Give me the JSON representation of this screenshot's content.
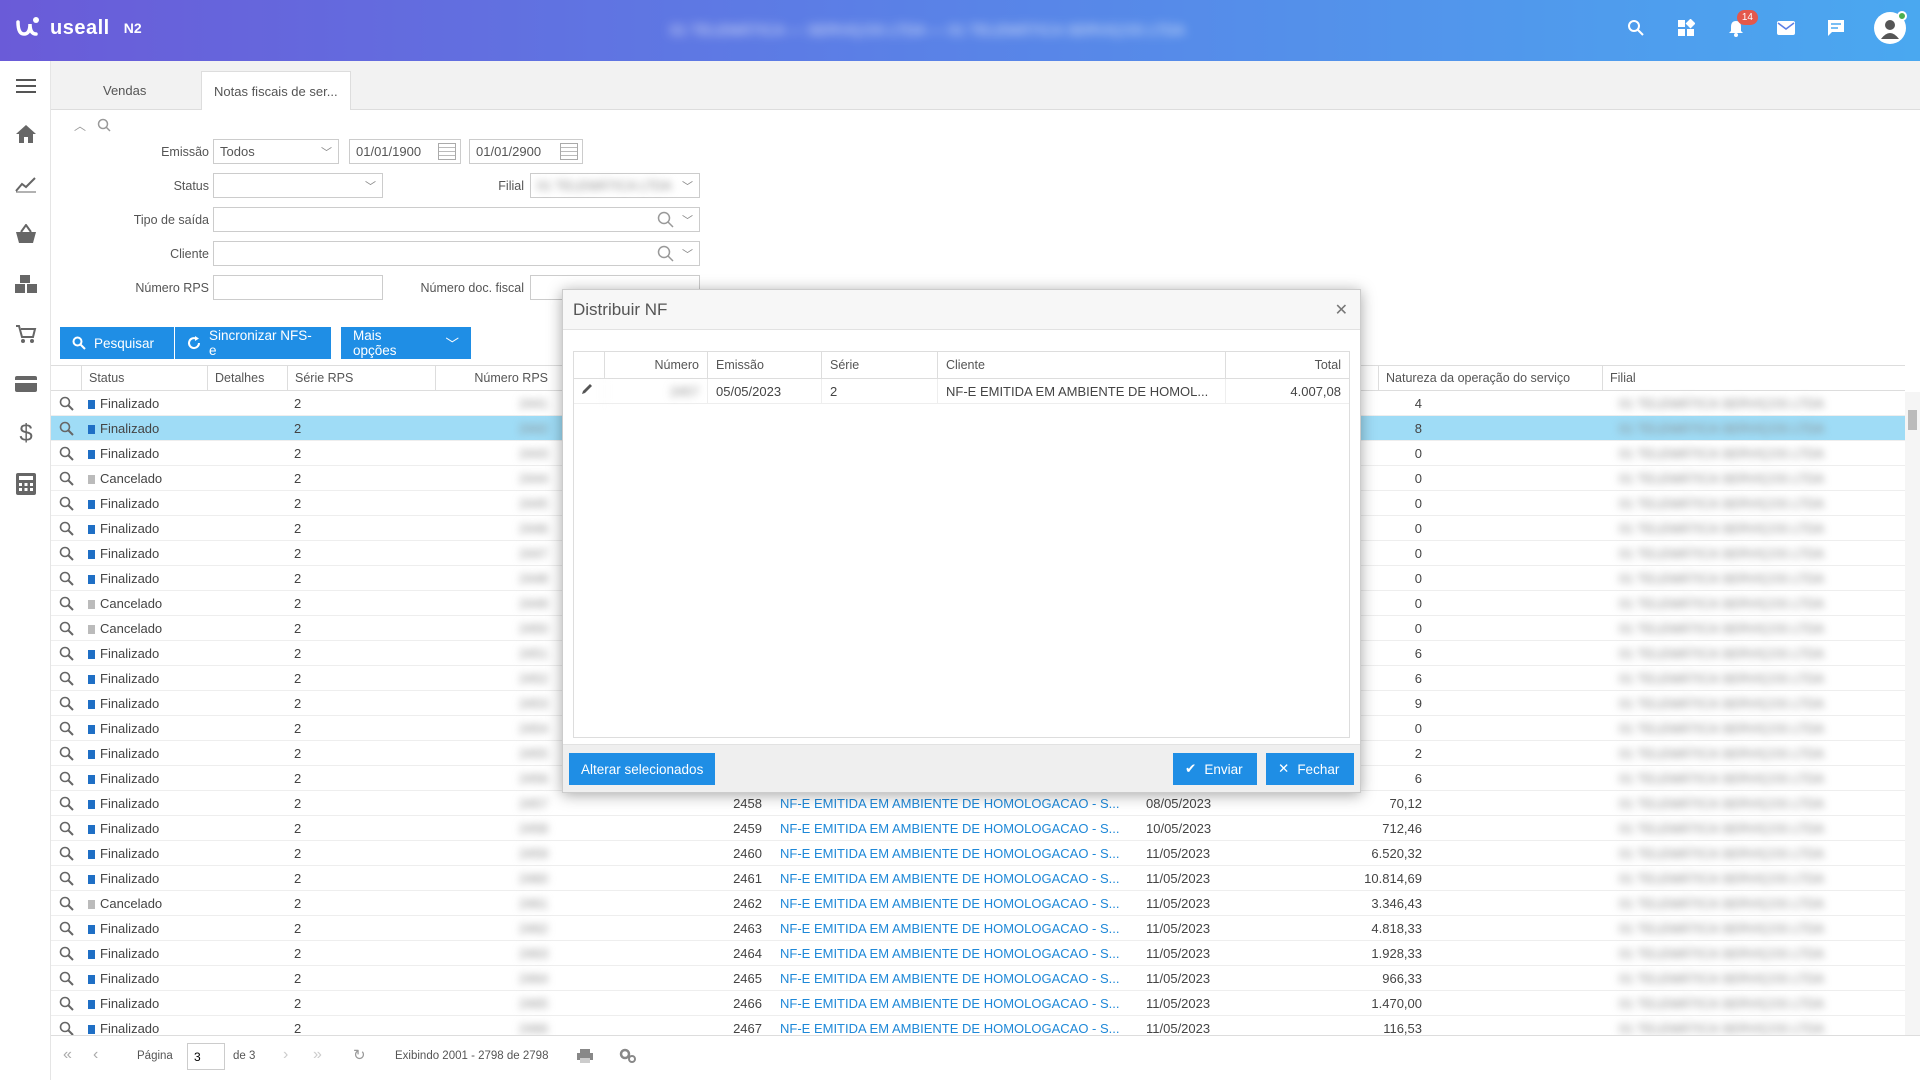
{
  "app": {
    "logo_text": "useall",
    "logo_sub": "N2",
    "top_title": "01 TELEMÁTICA — SERVIÇOS LTDA — 01 TELEMÁTICA SERVIÇOS LTDA",
    "notification_count": "14"
  },
  "tabs": [
    {
      "label": "Vendas"
    },
    {
      "label": "Notas fiscais de ser..."
    }
  ],
  "filters": {
    "emissao_label": "Emissão",
    "emissao_value": "Todos",
    "date_from": "01/01/1900",
    "date_to": "01/01/2900",
    "status_label": "Status",
    "filial_label": "Filial",
    "filial_value": "01 TELEMÁTICA LTDA",
    "tipo_saida_label": "Tipo de saída",
    "cliente_label": "Cliente",
    "numero_rps_label": "Número RPS",
    "numero_doc_label": "Número doc. fiscal"
  },
  "buttons": {
    "pesquisar": "Pesquisar",
    "sincronizar": "Sincronizar NFS-e",
    "mais_opcoes": "Mais opções"
  },
  "grid": {
    "headers": {
      "status": "Status",
      "detalhes": "Detalhes",
      "serie_rps": "Série RPS",
      "numero_rps": "Número RPS",
      "natureza": "Natureza da operação do serviço",
      "filial": "Filial"
    },
    "rows": [
      {
        "status": "Finalizado",
        "serie": "2",
        "rps": "2441",
        "num": "",
        "cliente": "",
        "emissao": "",
        "total": "4"
      },
      {
        "status": "Finalizado",
        "serie": "2",
        "rps": "2442",
        "num": "",
        "cliente": "",
        "emissao": "",
        "total": "8"
      },
      {
        "status": "Finalizado",
        "serie": "2",
        "rps": "2443",
        "num": "",
        "cliente": "",
        "emissao": "",
        "total": "0"
      },
      {
        "status": "Cancelado",
        "serie": "2",
        "rps": "2444",
        "num": "",
        "cliente": "",
        "emissao": "",
        "total": "0"
      },
      {
        "status": "Finalizado",
        "serie": "2",
        "rps": "2445",
        "num": "",
        "cliente": "",
        "emissao": "",
        "total": "0"
      },
      {
        "status": "Finalizado",
        "serie": "2",
        "rps": "2446",
        "num": "",
        "cliente": "",
        "emissao": "",
        "total": "0"
      },
      {
        "status": "Finalizado",
        "serie": "2",
        "rps": "2447",
        "num": "",
        "cliente": "",
        "emissao": "",
        "total": "0"
      },
      {
        "status": "Finalizado",
        "serie": "2",
        "rps": "2448",
        "num": "",
        "cliente": "",
        "emissao": "",
        "total": "0"
      },
      {
        "status": "Cancelado",
        "serie": "2",
        "rps": "2449",
        "num": "",
        "cliente": "",
        "emissao": "",
        "total": "0"
      },
      {
        "status": "Cancelado",
        "serie": "2",
        "rps": "2450",
        "num": "",
        "cliente": "",
        "emissao": "",
        "total": "0"
      },
      {
        "status": "Finalizado",
        "serie": "2",
        "rps": "2451",
        "num": "",
        "cliente": "",
        "emissao": "",
        "total": "6"
      },
      {
        "status": "Finalizado",
        "serie": "2",
        "rps": "2452",
        "num": "",
        "cliente": "",
        "emissao": "",
        "total": "6"
      },
      {
        "status": "Finalizado",
        "serie": "2",
        "rps": "2453",
        "num": "",
        "cliente": "",
        "emissao": "",
        "total": "9"
      },
      {
        "status": "Finalizado",
        "serie": "2",
        "rps": "2454",
        "num": "",
        "cliente": "",
        "emissao": "",
        "total": "0"
      },
      {
        "status": "Finalizado",
        "serie": "2",
        "rps": "2455",
        "num": "",
        "cliente": "",
        "emissao": "",
        "total": "2"
      },
      {
        "status": "Finalizado",
        "serie": "2",
        "rps": "2456",
        "num": "",
        "cliente": "",
        "emissao": "",
        "total": "6"
      },
      {
        "status": "Finalizado",
        "serie": "2",
        "rps": "2457",
        "num": "2458",
        "cliente": "NF-E EMITIDA EM AMBIENTE DE HOMOLOGACAO - S...",
        "emissao": "08/05/2023",
        "total": "70,12"
      },
      {
        "status": "Finalizado",
        "serie": "2",
        "rps": "2458",
        "num": "2459",
        "cliente": "NF-E EMITIDA EM AMBIENTE DE HOMOLOGACAO - S...",
        "emissao": "10/05/2023",
        "total": "712,46"
      },
      {
        "status": "Finalizado",
        "serie": "2",
        "rps": "2459",
        "num": "2460",
        "cliente": "NF-E EMITIDA EM AMBIENTE DE HOMOLOGACAO - S...",
        "emissao": "11/05/2023",
        "total": "6.520,32"
      },
      {
        "status": "Finalizado",
        "serie": "2",
        "rps": "2460",
        "num": "2461",
        "cliente": "NF-E EMITIDA EM AMBIENTE DE HOMOLOGACAO - S...",
        "emissao": "11/05/2023",
        "total": "10.814,69"
      },
      {
        "status": "Cancelado",
        "serie": "2",
        "rps": "2461",
        "num": "2462",
        "cliente": "NF-E EMITIDA EM AMBIENTE DE HOMOLOGACAO - S...",
        "emissao": "11/05/2023",
        "total": "3.346,43"
      },
      {
        "status": "Finalizado",
        "serie": "2",
        "rps": "2462",
        "num": "2463",
        "cliente": "NF-E EMITIDA EM AMBIENTE DE HOMOLOGACAO - S...",
        "emissao": "11/05/2023",
        "total": "4.818,33"
      },
      {
        "status": "Finalizado",
        "serie": "2",
        "rps": "2463",
        "num": "2464",
        "cliente": "NF-E EMITIDA EM AMBIENTE DE HOMOLOGACAO - S...",
        "emissao": "11/05/2023",
        "total": "1.928,33"
      },
      {
        "status": "Finalizado",
        "serie": "2",
        "rps": "2464",
        "num": "2465",
        "cliente": "NF-E EMITIDA EM AMBIENTE DE HOMOLOGACAO - S...",
        "emissao": "11/05/2023",
        "total": "966,33"
      },
      {
        "status": "Finalizado",
        "serie": "2",
        "rps": "2465",
        "num": "2466",
        "cliente": "NF-E EMITIDA EM AMBIENTE DE HOMOLOGACAO - S...",
        "emissao": "11/05/2023",
        "total": "1.470,00"
      },
      {
        "status": "Finalizado",
        "serie": "2",
        "rps": "2466",
        "num": "2467",
        "cliente": "NF-E EMITIDA EM AMBIENTE DE HOMOLOGACAO - S...",
        "emissao": "11/05/2023",
        "total": "116,53"
      }
    ],
    "filial_blurred": "01 TELEMÁTICA SERVIÇOS LTDA"
  },
  "pager": {
    "page_label": "Página",
    "page_value": "3",
    "of_label": "de 3",
    "showing": "Exibindo 2001 - 2798 de 2798"
  },
  "modal": {
    "title": "Distribuir NF",
    "headers": {
      "numero": "Número",
      "emissao": "Emissão",
      "serie": "Série",
      "cliente": "Cliente",
      "total": "Total"
    },
    "row": {
      "numero": "2457",
      "emissao": "05/05/2023",
      "serie": "2",
      "cliente": "NF-E EMITIDA EM AMBIENTE DE HOMOL...",
      "total": "4.007,08"
    },
    "alterar_label": "Alterar selecionados",
    "enviar_label": "Enviar",
    "fechar_label": "Fechar"
  },
  "colors": {
    "accent": "#1f8ee5",
    "finalizado": "#1f6fc5",
    "cancelado": "#bbbbbb",
    "selected_row": "#9fdcf6"
  }
}
